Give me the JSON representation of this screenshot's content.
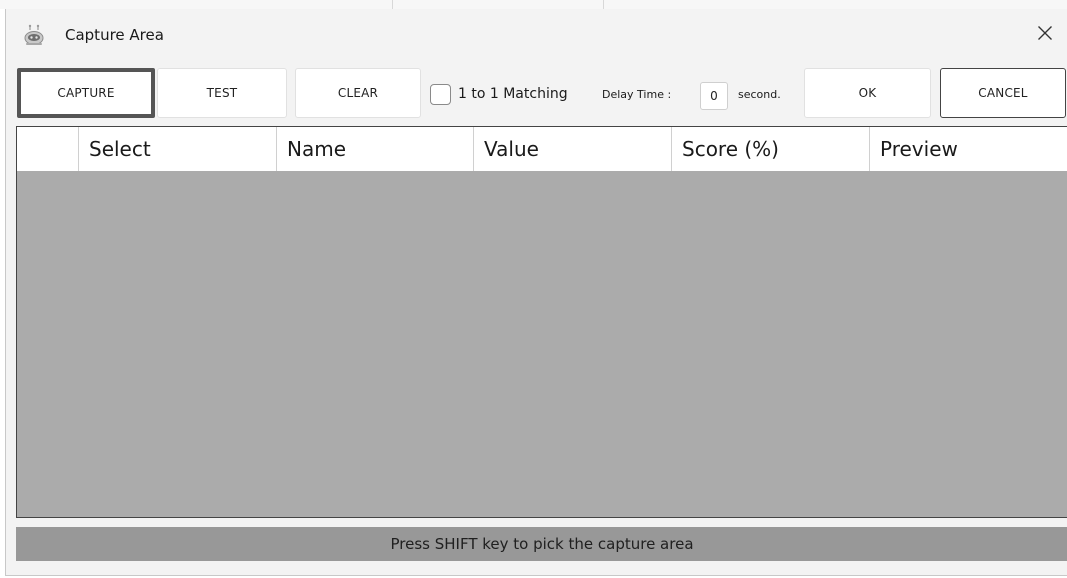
{
  "window": {
    "title": "Capture Area",
    "app_icon": "robot-icon",
    "close_icon": "close-icon"
  },
  "toolbar": {
    "capture_label": "CAPTURE",
    "test_label": "TEST",
    "clear_label": "CLEAR",
    "matching_label": "1 to 1 Matching",
    "matching_checked": false,
    "delay_label": "Delay Time :",
    "delay_value": "0",
    "second_label": "second.",
    "ok_label": "OK",
    "cancel_label": "CANCEL"
  },
  "grid": {
    "columns": [
      "",
      "Select",
      "Name",
      "Value",
      "Score (%)",
      "Preview"
    ],
    "rows": []
  },
  "status": {
    "message": "Press SHIFT key to pick the capture area"
  },
  "colors": {
    "grid_empty_bg": "#ababab",
    "status_bg": "#989898",
    "capture_border": "#555555"
  }
}
